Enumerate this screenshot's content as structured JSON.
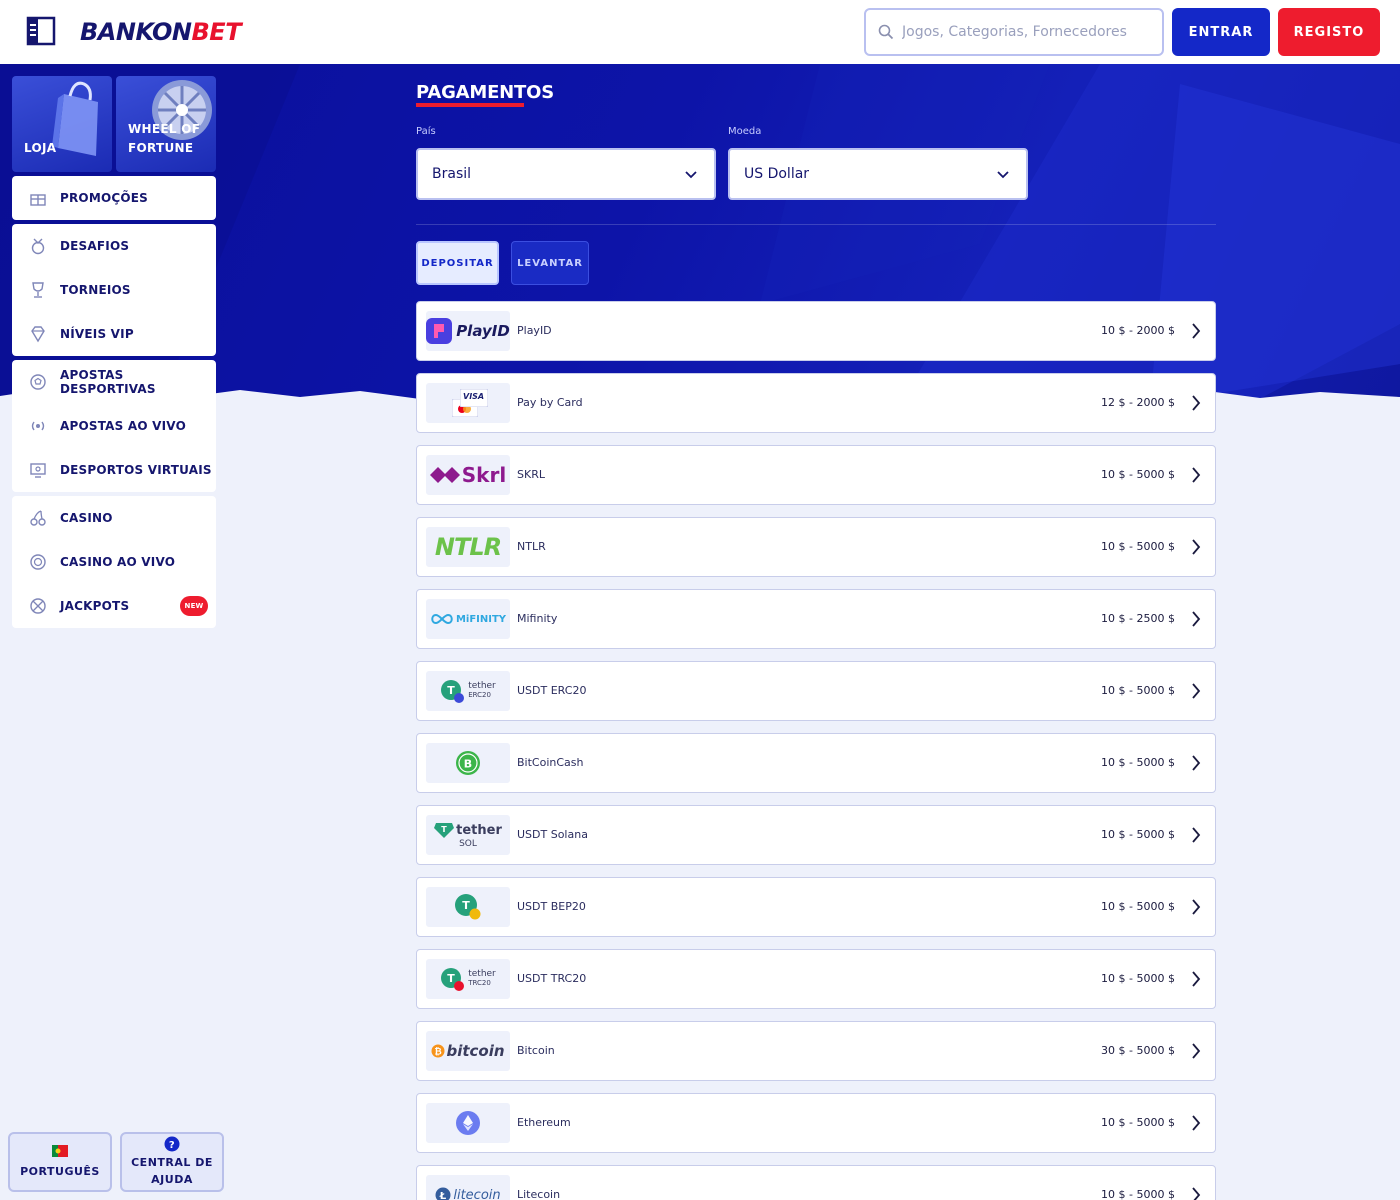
{
  "header": {
    "logo_part1": "BANKON",
    "logo_part2": "BET",
    "search_placeholder": "Jogos, Categorias, Fornecedores",
    "login_label": "ENTRAR",
    "register_label": "REGISTO"
  },
  "sidebar": {
    "tiles": [
      {
        "label": "LOJA"
      },
      {
        "label": "WHEEL OF FORTUNE",
        "line1": "WHEEL OF",
        "line2": "FORTUNE"
      }
    ],
    "groups": [
      [
        {
          "label": "PROMOÇÕES",
          "icon": "gift-icon"
        }
      ],
      [
        {
          "label": "DESAFIOS",
          "icon": "medal-icon"
        },
        {
          "label": "TORNEIOS",
          "icon": "trophy-icon"
        },
        {
          "label": "NÍVEIS VIP",
          "icon": "diamond-icon"
        }
      ],
      [
        {
          "label": "APOSTAS DESPORTIVAS",
          "icon": "soccer-ball-icon"
        },
        {
          "label": "APOSTAS AO VIVO",
          "icon": "broadcast-icon"
        },
        {
          "label": "DESPORTOS VIRTUAIS",
          "icon": "monitor-icon"
        }
      ],
      [
        {
          "label": "CASINO",
          "icon": "cherries-icon"
        },
        {
          "label": "CASINO AO VIVO",
          "icon": "chip-icon"
        },
        {
          "label": "JACKPOTS",
          "icon": "jackpot-icon",
          "badge": "NEW"
        }
      ]
    ],
    "footer": {
      "language_label": "PORTUGUÊS",
      "help_line1": "CENTRAL DE",
      "help_line2": "AJUDA"
    }
  },
  "main": {
    "title": "PAGAMENTOS",
    "country_label": "País",
    "country_value": "Brasil",
    "currency_label": "Moeda",
    "currency_value": "US Dollar",
    "tabs": [
      {
        "label": "DEPOSITAR",
        "active": true
      },
      {
        "label": "LEVANTAR",
        "active": false
      }
    ],
    "methods": [
      {
        "name": "PlayID",
        "range": "10 $ - 2000 $",
        "logo": "PlayID"
      },
      {
        "name": "Pay by Card",
        "range": "12 $ - 2000 $",
        "logo": "VISA"
      },
      {
        "name": "SKRL",
        "range": "10 $ - 5000 $",
        "logo": "Skrl"
      },
      {
        "name": "NTLR",
        "range": "10 $ - 5000 $",
        "logo": "NTLR"
      },
      {
        "name": "Mifinity",
        "range": "10 $ - 2500 $",
        "logo": "MiFINITY"
      },
      {
        "name": "USDT ERC20",
        "range": "10 $ - 5000 $",
        "logo": "tether",
        "logo_sub": "ERC20"
      },
      {
        "name": "BitCoinCash",
        "range": "10 $ - 5000 $",
        "logo": "B"
      },
      {
        "name": "USDT Solana",
        "range": "10 $ - 5000 $",
        "logo": "tether",
        "logo_sub": "SOL"
      },
      {
        "name": "USDT BEP20",
        "range": "10 $ - 5000 $",
        "logo": "T"
      },
      {
        "name": "USDT TRC20",
        "range": "10 $ - 5000 $",
        "logo": "tether",
        "logo_sub": "TRC20"
      },
      {
        "name": "Bitcoin",
        "range": "30 $ - 5000 $",
        "logo": "bitcoin"
      },
      {
        "name": "Ethereum",
        "range": "10 $ - 5000 $",
        "logo": "ETH"
      },
      {
        "name": "Litecoin",
        "range": "10 $ - 5000 $",
        "logo": "litecoin"
      }
    ]
  },
  "colors": {
    "brand_navy": "#15166e",
    "brand_red": "#ee1c2e",
    "brand_blue": "#1428c8",
    "hero_blue": "#0d14a8"
  }
}
